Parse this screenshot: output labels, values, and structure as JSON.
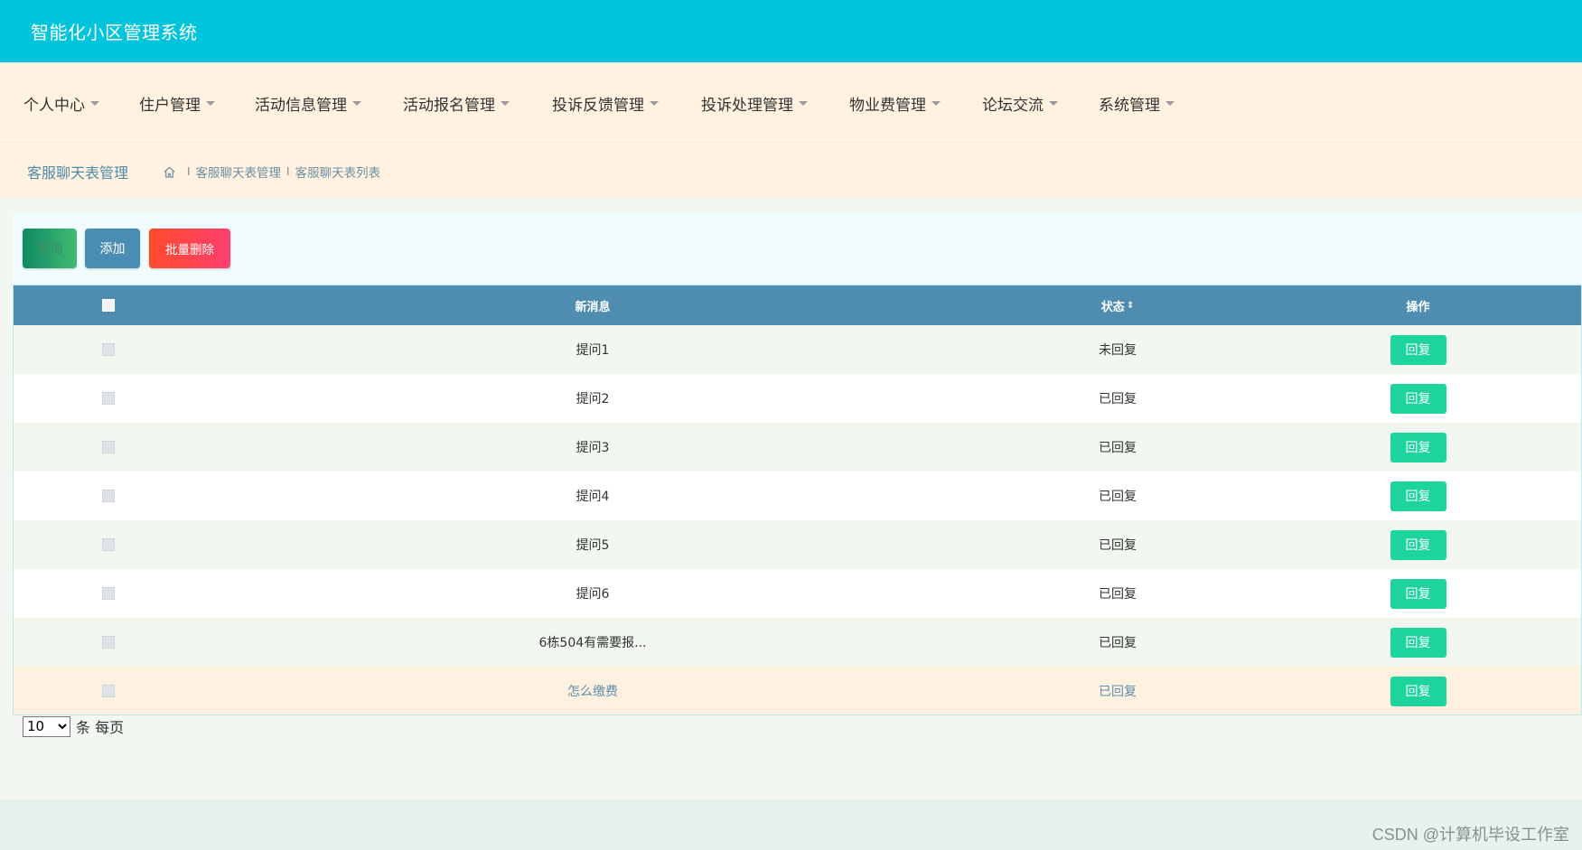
{
  "app": {
    "title": "智能化小区管理系统"
  },
  "nav": [
    {
      "label": "个人中心"
    },
    {
      "label": "住户管理"
    },
    {
      "label": "活动信息管理"
    },
    {
      "label": "活动报名管理"
    },
    {
      "label": "投诉反馈管理"
    },
    {
      "label": "投诉处理管理"
    },
    {
      "label": "物业费管理"
    },
    {
      "label": "论坛交流"
    },
    {
      "label": "系统管理"
    }
  ],
  "page": {
    "title": "客服聊天表管理",
    "breadcrumb": [
      "客服聊天表管理",
      "客服聊天表列表"
    ],
    "breadcrumb_sep": "I"
  },
  "toolbar": {
    "search_label": "查询",
    "add_label": "添加",
    "batch_delete_label": "批量删除"
  },
  "table": {
    "headers": {
      "message": "新消息",
      "status": "状态",
      "operation": "操作"
    },
    "rows": [
      {
        "message": "提问1",
        "status": "未回复",
        "action": "回复"
      },
      {
        "message": "提问2",
        "status": "已回复",
        "action": "回复"
      },
      {
        "message": "提问3",
        "status": "已回复",
        "action": "回复"
      },
      {
        "message": "提问4",
        "status": "已回复",
        "action": "回复"
      },
      {
        "message": "提问5",
        "status": "已回复",
        "action": "回复"
      },
      {
        "message": "提问6",
        "status": "已回复",
        "action": "回复"
      },
      {
        "message": "6栋504有需要报...",
        "status": "已回复",
        "action": "回复"
      },
      {
        "message": "怎么缴费",
        "status": "已回复",
        "action": "回复"
      }
    ]
  },
  "pagination": {
    "page_size": "10",
    "page_size_options": [
      "10"
    ],
    "suffix": "条 每页"
  },
  "watermark": "CSDN @计算机毕设工作室",
  "colors": {
    "topbar": "#00c4dc",
    "nav_bg": "#fff2e0",
    "table_header": "#4e8daf",
    "reply_button": "#1dd49d",
    "add_button": "#4a8db3",
    "delete_button": "#ff4a2c"
  }
}
